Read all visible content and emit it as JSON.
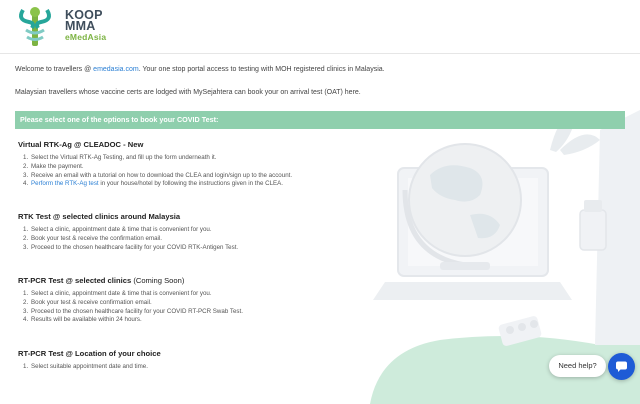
{
  "brand": {
    "name_line1": "KOOP",
    "name_line2": "MMA",
    "sub": "eMedAsia"
  },
  "intro": {
    "line1_prefix": "Welcome to travellers @ ",
    "line1_link": "emedasia.com",
    "line1_suffix": ". Your one stop portal access to testing with MOH registered clinics in Malaysia.",
    "line2": "Malaysian travellers whose vaccine certs are lodged with MySejahtera can book your on arrival test (OAT) here."
  },
  "banner": "Please select one of the options to book your COVID Test:",
  "sections": [
    {
      "title": "Virtual RTK-Ag @ CLEADOC - New",
      "items": [
        "Select the Virtual RTK-Ag Testing, and fill up the form underneath it.",
        "Make the payment.",
        "Receive an email with a tutorial on how to download the CLEA and login/sign up to the account."
      ],
      "item4_link": "Perform the RTK-Ag test",
      "item4_rest": " in your house/hotel by following the instructions given in the CLEA."
    },
    {
      "title": "RTK Test @ selected clinics around Malaysia",
      "items": [
        "Select a clinic, appointment date & time that is convenient for you.",
        "Book your test & receive the confirmation email.",
        "Proceed to the chosen healthcare facility for your COVID RTK-Antigen Test."
      ]
    },
    {
      "title": "RT-PCR Test @ selected clinics",
      "note": " (Coming Soon)",
      "items": [
        "Select a clinic, appointment date & time that is convenient for you.",
        "Book your test & receive confirmation email.",
        "Proceed to the chosen healthcare facility for your COVID RT-PCR Swab Test.",
        "Results will be available within 24 hours."
      ]
    },
    {
      "title": "RT-PCR Test @ Location of your choice",
      "items": [
        "Select suitable appointment date and time."
      ]
    }
  ],
  "help": {
    "label": "Need help?"
  },
  "colors": {
    "accent_green": "#8fcfad",
    "link_blue": "#2a7fd4",
    "chat_blue": "#1e5bd6"
  }
}
